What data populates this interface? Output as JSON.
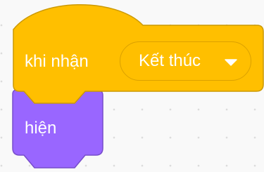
{
  "event_block": {
    "label": "khi nhận",
    "dropdown_value": "Kết thúc",
    "dropdown_icon": "triangle-down-icon",
    "fill_color": "#FFBF00",
    "border_color": "#CC9900"
  },
  "looks_block": {
    "label": "hiện",
    "fill_color": "#9966FF",
    "border_color": "#774DCB"
  }
}
